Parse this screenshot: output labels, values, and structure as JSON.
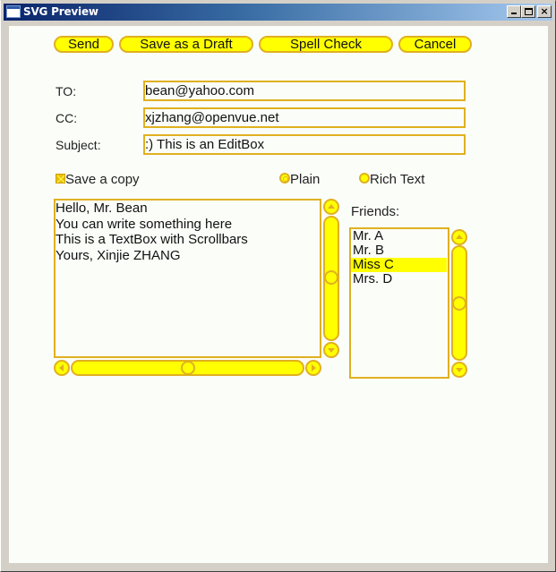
{
  "window": {
    "title": "SVG Preview",
    "controls": {
      "minimize": "minimize",
      "maximize": "maximize",
      "close": "×"
    }
  },
  "toolbar": {
    "send_label": "Send",
    "draft_label": "Save as a Draft",
    "spell_label": "Spell Check",
    "cancel_label": "Cancel"
  },
  "form": {
    "to_label": "TO:",
    "to_value": "bean@yahoo.com",
    "cc_label": "CC:",
    "cc_value": "xjzhang@openvue.net",
    "subject_label": "Subject:",
    "subject_value": ":) This is an EditBox"
  },
  "options": {
    "save_copy_label": "Save a copy",
    "save_copy_checked": true,
    "format": {
      "selected": "Plain",
      "plain_label": "Plain",
      "rich_label": "Rich Text"
    }
  },
  "body": {
    "lines": [
      "Hello, Mr. Bean",
      "You can write something here",
      "This is a TextBox with Scrollbars",
      "Yours, Xinjie ZHANG"
    ],
    "vscroll_position": 0.5,
    "hscroll_position": 0.5
  },
  "friends": {
    "label": "Friends:",
    "items": [
      "Mr. A",
      "Mr. B",
      "Miss C",
      "Mrs. D"
    ],
    "selected_index": 2,
    "vscroll_position": 0.5
  },
  "colors": {
    "accent_fill": "#ffff00",
    "accent_border": "#e0b020"
  }
}
